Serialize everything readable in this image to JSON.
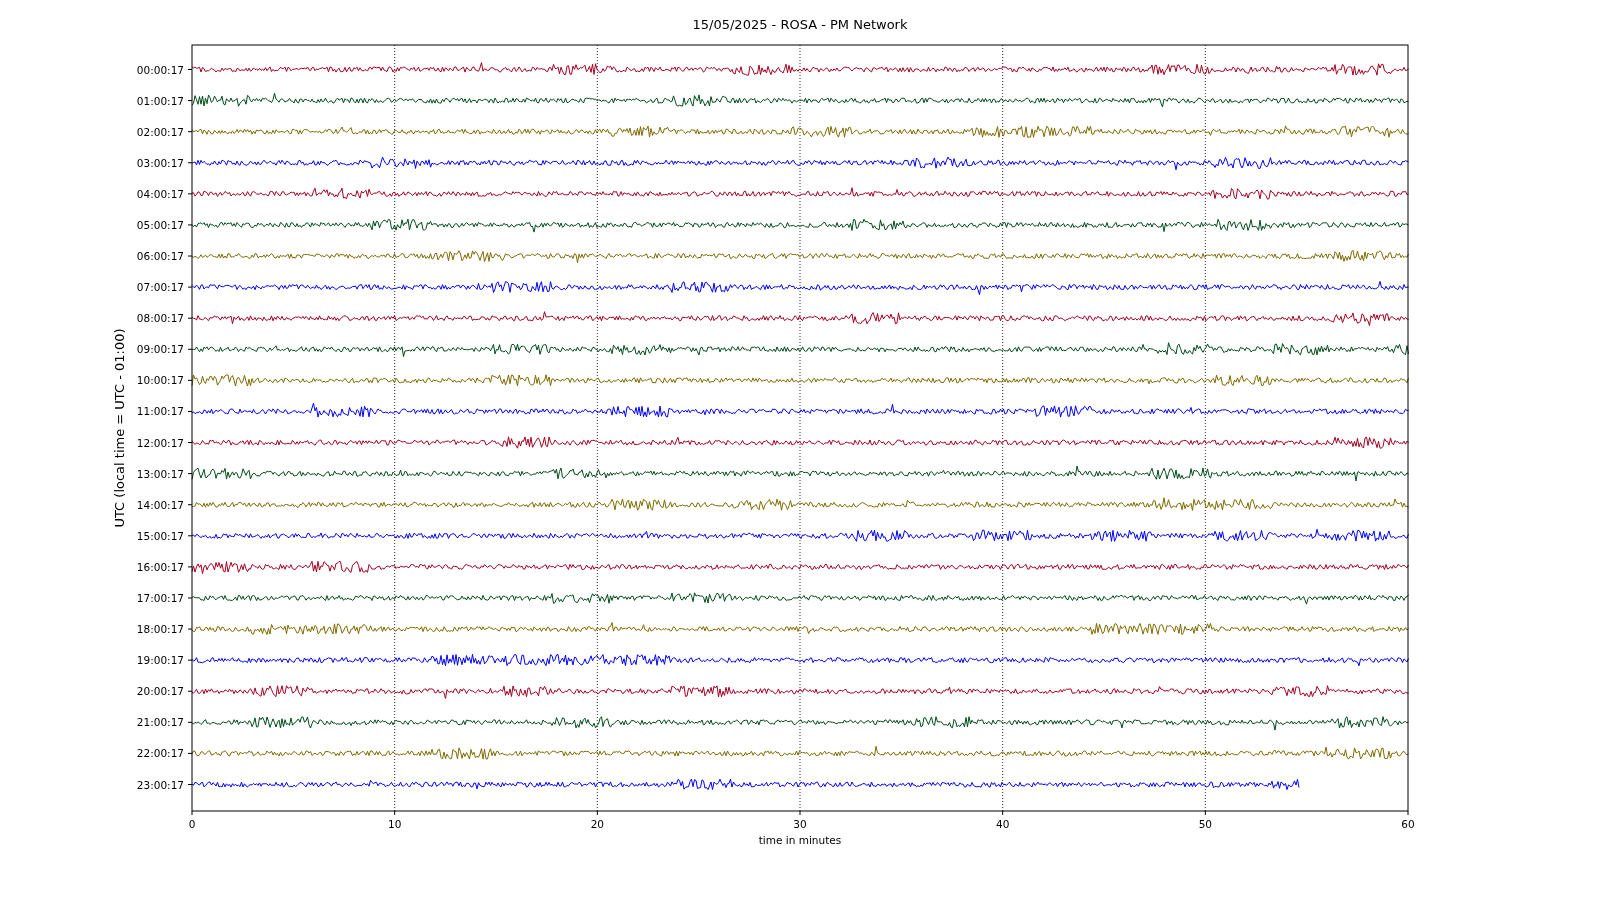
{
  "chart": {
    "title": "15/05/2025 - ROSA - PM Network",
    "xlabel": "time in minutes",
    "ylabel": "UTC (local time = UTC - 01:00)",
    "xticks": [
      "0",
      "10",
      "20",
      "30",
      "40",
      "50",
      "60"
    ],
    "traces": [
      {
        "label": "00:00:17",
        "color": "#a50021",
        "level": 1
      },
      {
        "label": "01:00:17",
        "color": "#004c18",
        "level": 1
      },
      {
        "label": "02:00:17",
        "color": "#7f6a00",
        "level": 1
      },
      {
        "label": "03:00:17",
        "color": "#0000ff",
        "level": 1
      },
      {
        "label": "04:00:17",
        "color": "#a50021",
        "level": 1
      },
      {
        "label": "05:00:17",
        "color": "#004c18",
        "level": 1
      },
      {
        "label": "06:00:17",
        "color": "#7f6a00",
        "level": 1
      },
      {
        "label": "07:00:17",
        "color": "#0000ff",
        "level": 1
      },
      {
        "label": "08:00:17",
        "color": "#a50021",
        "level": 1
      },
      {
        "label": "09:00:17",
        "color": "#004c18",
        "level": 1
      },
      {
        "label": "10:00:17",
        "color": "#7f6a00",
        "level": 1
      },
      {
        "label": "11:00:17",
        "color": "#0000ff",
        "level": 1
      },
      {
        "label": "12:00:17",
        "color": "#a50021",
        "level": 1
      },
      {
        "label": "13:00:17",
        "color": "#004c18",
        "level": 1
      },
      {
        "label": "14:00:17",
        "color": "#7f6a00",
        "level": 1
      },
      {
        "label": "15:00:17",
        "color": "#0000ff",
        "level": 1
      },
      {
        "label": "16:00:17",
        "color": "#a50021",
        "level": 1
      },
      {
        "label": "17:00:17",
        "color": "#004c18",
        "level": 1
      },
      {
        "label": "18:00:17",
        "color": "#7f6a00",
        "level": 1
      },
      {
        "label": "19:00:17",
        "color": "#0000ff",
        "level": 1
      },
      {
        "label": "20:00:17",
        "color": "#a50021",
        "level": 1
      },
      {
        "label": "21:00:17",
        "color": "#004c18",
        "level": 1
      },
      {
        "label": "22:00:17",
        "color": "#7f6a00",
        "level": 1
      },
      {
        "label": "23:00:17",
        "color": "#0000ff",
        "level": 0.91
      }
    ]
  }
}
